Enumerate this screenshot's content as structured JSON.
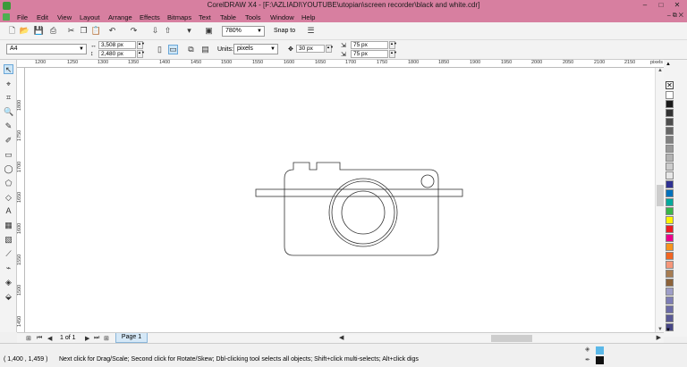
{
  "window": {
    "title": "CorelDRAW X4 - [F:\\AZLIADI\\YOUTUBE\\utopian\\screen recorder\\black and white.cdr]",
    "minimize": "–",
    "maximize": "□",
    "close": "✕"
  },
  "menu": {
    "items": [
      "File",
      "Edit",
      "View",
      "Layout",
      "Arrange",
      "Effects",
      "Bitmaps",
      "Text",
      "Table",
      "Tools",
      "Window",
      "Help"
    ],
    "mdi_buttons": "– ⧉ ✕"
  },
  "toolbar": {
    "zoom_value": "780%",
    "snap_label": "Snap to"
  },
  "propbar": {
    "paper_size": "A4",
    "width": "3,508 px",
    "height": "2,480 px",
    "units_label": "Units:",
    "units_value": "pixels",
    "nudge": "30 px",
    "dup_x": "75 px",
    "dup_y": "75 px"
  },
  "ruler": {
    "h_ticks": [
      "1200",
      "1250",
      "1300",
      "1350",
      "1400",
      "1450",
      "1500",
      "1550",
      "1600",
      "1650",
      "1700",
      "1750",
      "1800",
      "1850",
      "1900",
      "1950",
      "2000",
      "2050",
      "2100",
      "2150",
      "pixels"
    ],
    "v_ticks": [
      "1800",
      "1750",
      "1700",
      "1650",
      "1600",
      "1550",
      "1500",
      "1450",
      "1400"
    ]
  },
  "pages": {
    "count_text": "1 of 1",
    "tab_label": "Page 1"
  },
  "status": {
    "coords": "( 1,400 , 1,459 )",
    "hint": "Next click for Drag/Scale; Second click for Rotate/Skew; Dbl-clicking tool selects all objects; Shift+click multi-selects; Alt+click digs",
    "fill_color": "#5bb8e8",
    "outline_color": "#111111"
  },
  "palette": {
    "colors": [
      "#ffffff",
      "#1a1a1a",
      "#333333",
      "#4d4d4d",
      "#666666",
      "#808080",
      "#999999",
      "#b3b3b3",
      "#cccccc",
      "#e6e6e6",
      "#2e3192",
      "#0071bc",
      "#00a99d",
      "#39b54a",
      "#fff200",
      "#ed1c24",
      "#ec008c",
      "#f7941d",
      "#f26522",
      "#f69679",
      "#a67c52",
      "#8c6239",
      "#9e9ec8",
      "#7d7db5",
      "#6b6ba6",
      "#595996",
      "#474787"
    ]
  }
}
